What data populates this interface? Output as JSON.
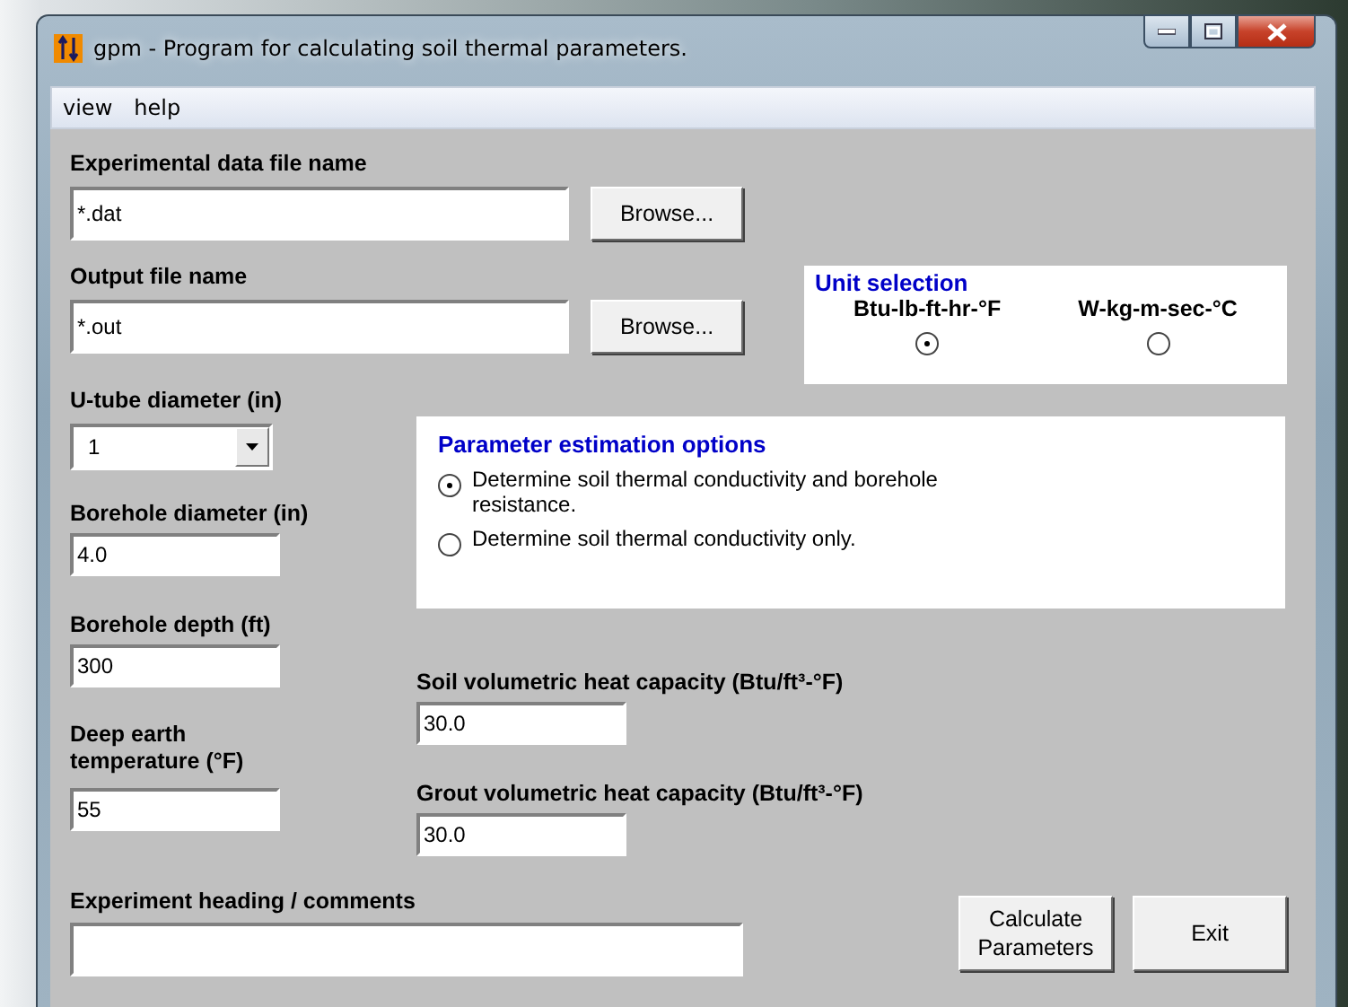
{
  "window": {
    "title": "gpm - Program for calculating soil thermal parameters."
  },
  "menu": [
    {
      "label": "view"
    },
    {
      "label": "help"
    }
  ],
  "experimental_data_file": {
    "label": "Experimental data file name",
    "value": "*.dat",
    "button": "Browse..."
  },
  "output_file": {
    "label": "Output file name",
    "value": "*.out",
    "button": "Browse..."
  },
  "unit_selection": {
    "title": "Unit selection",
    "options": [
      {
        "label": "Btu-lb-ft-hr-°F",
        "selected": true
      },
      {
        "label": "W-kg-m-sec-°C",
        "selected": false
      }
    ]
  },
  "u_tube_diameter": {
    "label": "U-tube diameter (in)",
    "value": "1"
  },
  "parameter_estimation": {
    "title": "Parameter estimation options",
    "options": [
      {
        "label": "Determine soil thermal conductivity and borehole resistance.",
        "selected": true
      },
      {
        "label": "Determine soil thermal conductivity only.",
        "selected": false
      }
    ]
  },
  "borehole_diameter": {
    "label": "Borehole diameter (in)",
    "value": "4.0"
  },
  "borehole_depth": {
    "label": "Borehole depth (ft)",
    "value": "300"
  },
  "deep_earth_temperature": {
    "label": "Deep earth temperature (°F)",
    "value": "55"
  },
  "soil_heat_capacity": {
    "label": "Soil volumetric heat capacity (Btu/ft³-°F)",
    "value": "30.0"
  },
  "grout_heat_capacity": {
    "label": "Grout volumetric heat capacity (Btu/ft³-°F)",
    "value": "30.0"
  },
  "experiment_heading": {
    "label": "Experiment heading / comments"
  },
  "buttons": [
    "Calculate Parameters",
    "Exit"
  ]
}
